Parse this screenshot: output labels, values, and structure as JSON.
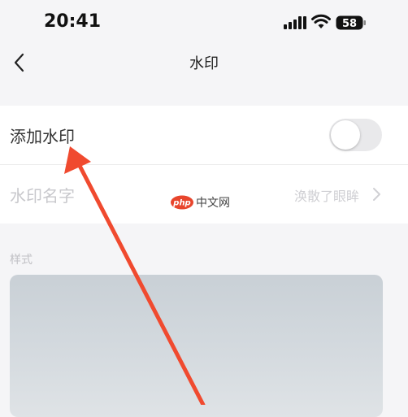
{
  "status_bar": {
    "time": "20:41",
    "battery_level": "58"
  },
  "nav": {
    "title": "水印",
    "back_icon": "chevron-left-icon"
  },
  "settings": {
    "add_watermark": {
      "label": "添加水印",
      "enabled": false
    },
    "watermark_name": {
      "label": "水印名字",
      "value": "涣散了眼眸",
      "icon": "chevron-right-icon"
    }
  },
  "style_section": {
    "label": "样式"
  },
  "overlay": {
    "logo_text": "中文网",
    "logo_mark": "php",
    "arrow_color": "#f04a2f"
  },
  "colors": {
    "background": "#f5f5f7",
    "card": "#ffffff",
    "toggle_off": "#e9e9eb"
  }
}
